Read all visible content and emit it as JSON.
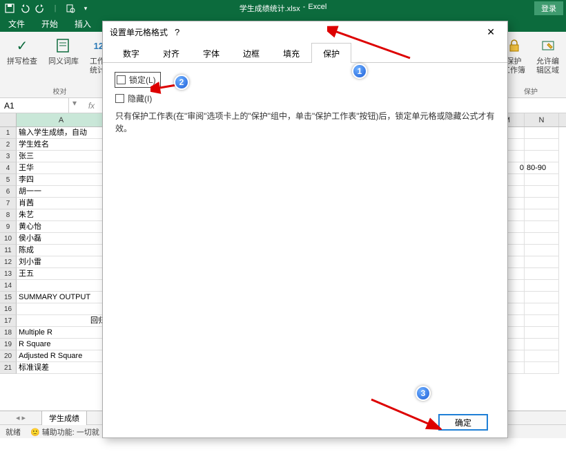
{
  "titlebar": {
    "doc": "学生成绩统计.xlsx",
    "app": "Excel",
    "login": "登录"
  },
  "tabs": {
    "file": "文件",
    "home": "开始",
    "insert": "插入"
  },
  "ribbon": {
    "proof_group": "校对",
    "spell": "拼写检查",
    "thesaurus": "同义词库",
    "workbook_stats": "工作簿\n统计信",
    "protect_group": "保护",
    "protect_sheet": "保护\n工作簿",
    "allow_edit": "允许编\n辑区域"
  },
  "namebox": "A1",
  "rows_colA": [
    "输入学生成绩，自动",
    "学生姓名",
    "张三",
    "王华",
    "李四",
    "胡一一",
    "肖茜",
    "朱艺",
    "黄心怡",
    "侯小磊",
    "陈成",
    "刘小雷",
    "王五",
    "",
    "SUMMARY OUTPUT",
    "",
    "回归",
    "Multiple R",
    "R Square",
    "Adjusted R Square",
    "标准误差"
  ],
  "right_col_M": "0",
  "right_col_N": "80-90",
  "sheettab": "学生成绩",
  "status": {
    "ready": "就绪",
    "access": "辅助功能: 一切就"
  },
  "dialog": {
    "title": "设置单元格格式",
    "tabs": [
      "数字",
      "对齐",
      "字体",
      "边框",
      "填充",
      "保护"
    ],
    "lock": "锁定(L)",
    "hide": "隐藏(I)",
    "note": "只有保护工作表(在\"审阅\"选项卡上的\"保护\"组中，单击\"保护工作表\"按钮)后，锁定单元格或隐藏公式才有效。",
    "ok": "确定"
  },
  "badges": {
    "b1": "1",
    "b2": "2",
    "b3": "3"
  }
}
